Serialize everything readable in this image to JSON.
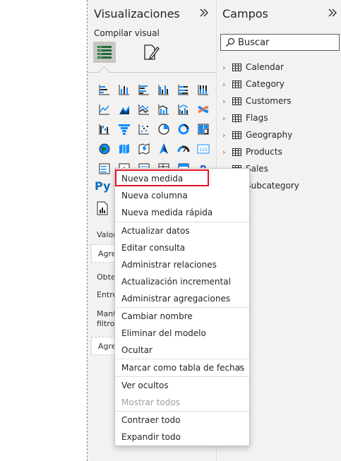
{
  "visualizations": {
    "title": "Visualizaciones",
    "expand_icon": "double-chevron-right-icon",
    "compile_label": "Compilar visual",
    "python_label": "Py",
    "values_label": "Valor",
    "add_field_1": "Agre",
    "drill_label": "Obte",
    "between_label": "Entre",
    "keep_filters_1": "Mant",
    "keep_filters_2": "filtro",
    "add_field_2": "Agre"
  },
  "fields": {
    "title": "Campos",
    "expand_icon": "double-chevron-right-icon",
    "search_placeholder": "Buscar",
    "tables": [
      "Calendar",
      "Category",
      "Customers",
      "Flags",
      "Geography",
      "Products",
      "Sales",
      "Subcategory"
    ]
  },
  "context_menu": {
    "items": [
      {
        "label": "Nueva medida",
        "highlighted": true
      },
      {
        "label": "Nueva columna"
      },
      {
        "label": "Nueva medida rápida"
      },
      {
        "label": "Actualizar datos"
      },
      {
        "label": "Editar consulta"
      },
      {
        "label": "Administrar relaciones"
      },
      {
        "label": "Actualización incremental"
      },
      {
        "label": "Administrar agregaciones"
      },
      {
        "label": "Cambiar nombre"
      },
      {
        "label": "Eliminar del modelo"
      },
      {
        "label": "Ocultar"
      },
      {
        "label": "Marcar como tabla de fechas",
        "submenu": true
      },
      {
        "label": "Ver ocultos"
      },
      {
        "label": "Mostrar todos",
        "disabled": true
      },
      {
        "label": "Contraer todo"
      },
      {
        "label": "Expandir todo"
      }
    ]
  },
  "colors": {
    "accent_blue": "#118dff",
    "dark_blue": "#0a3c6e",
    "highlight_red": "#e81123"
  }
}
